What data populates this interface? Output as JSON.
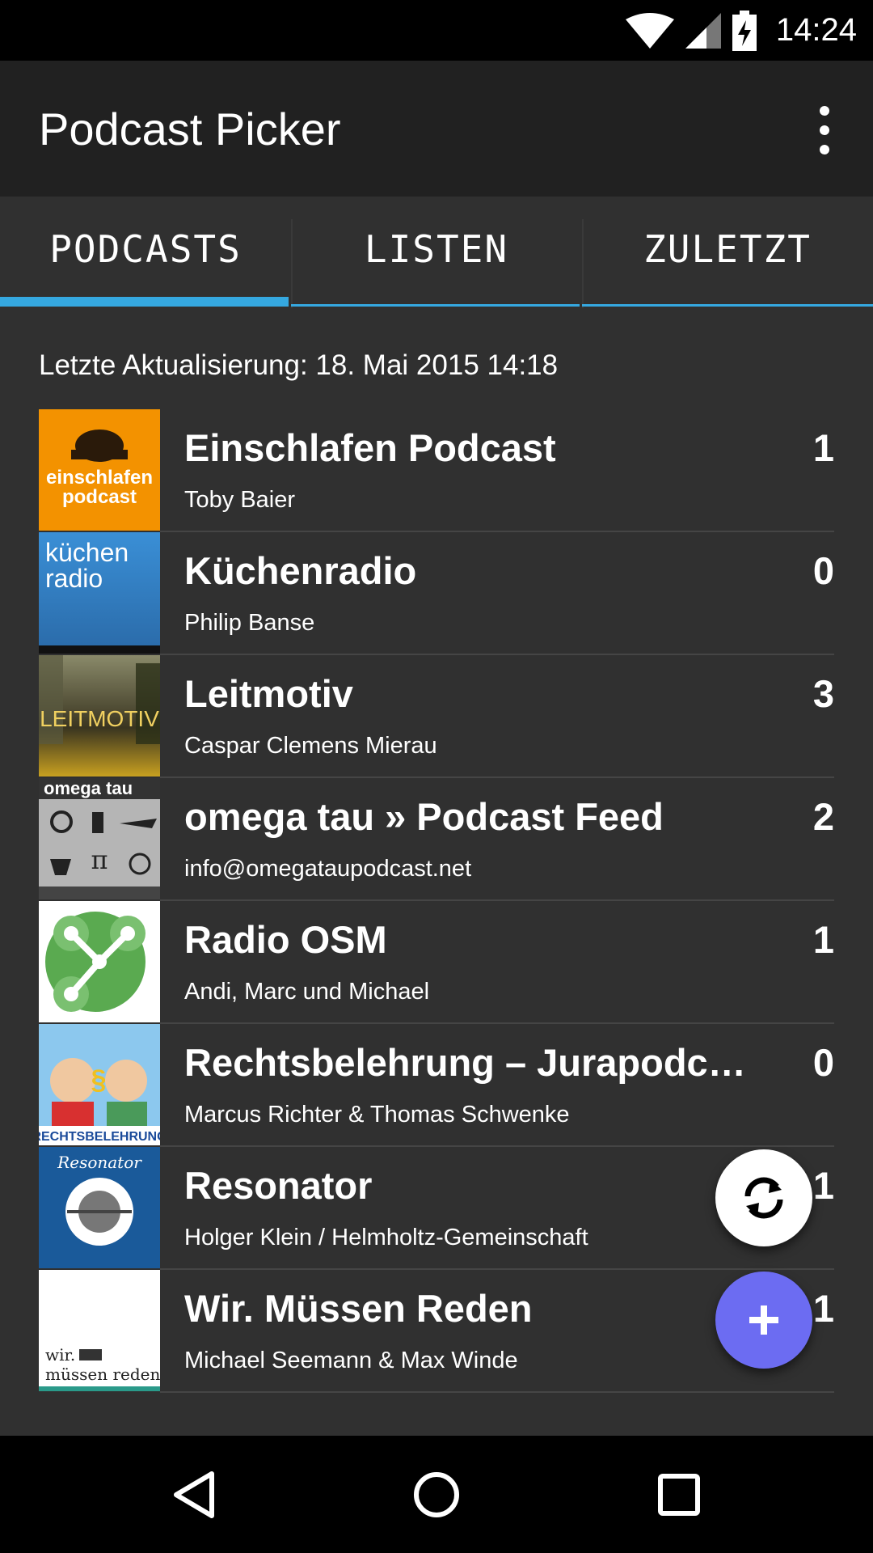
{
  "status_bar": {
    "time": "14:24",
    "icons": [
      "wifi-icon",
      "signal-icon",
      "battery-charging-icon"
    ]
  },
  "app_bar": {
    "title": "Podcast Picker",
    "menu_icon": "overflow-menu-icon"
  },
  "tabs": [
    {
      "label": "PODCASTS",
      "active": true
    },
    {
      "label": "LISTEN",
      "active": false
    },
    {
      "label": "ZULETZT",
      "active": false
    }
  ],
  "last_update": "Letzte Aktualisierung: 18. Mai 2015 14:18",
  "podcasts": [
    {
      "title": "Einschlafen Podcast",
      "author": "Toby Baier",
      "count": "1",
      "cover_text": "einschlafen podcast"
    },
    {
      "title": "Küchenradio",
      "author": "Philip Banse",
      "count": "0",
      "cover_text": "küchen radio"
    },
    {
      "title": "Leitmotiv",
      "author": "Caspar Clemens Mierau",
      "count": "3",
      "cover_text": "LEITMOTIV"
    },
    {
      "title": "omega tau » Podcast Feed",
      "author": "info@omegataupodcast.net",
      "count": "2",
      "cover_text": "omega tau"
    },
    {
      "title": "Radio OSM",
      "author": "Andi, Marc und Michael",
      "count": "1",
      "cover_text": ""
    },
    {
      "title": "Rechtsbelehrung – Jurapodcast…",
      "author": "Marcus Richter & Thomas Schwenke",
      "count": "0",
      "cover_text": "RECHTSBELEHRUNG"
    },
    {
      "title": "Resonator",
      "author": "Holger Klein / Helmholtz-Gemeinschaft",
      "count": "1",
      "cover_text": "Resonator"
    },
    {
      "title": "Wir. Müssen Reden",
      "author": "Michael Seemann & Max Winde",
      "count": "1",
      "cover_text": "wir. müssen reden"
    }
  ],
  "fabs": {
    "sync_icon": "sync-icon",
    "add_icon": "plus-icon"
  },
  "nav_bar": {
    "icons": [
      "back-icon",
      "home-icon",
      "recents-icon"
    ]
  },
  "colors": {
    "accent": "#35a8e0",
    "fab_add": "#6c6cf2",
    "background": "#303030",
    "app_bar": "#212121"
  }
}
